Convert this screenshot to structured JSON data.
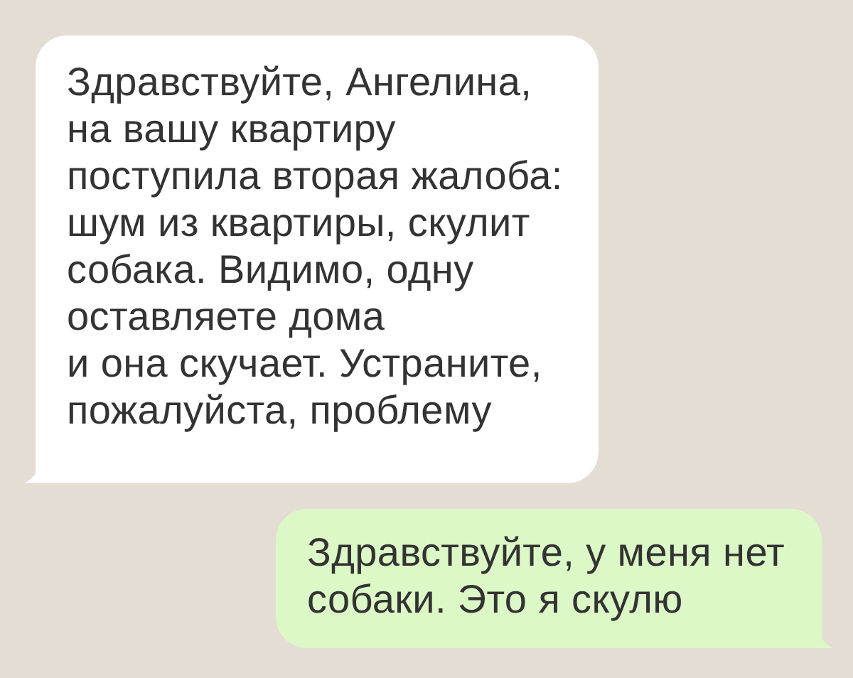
{
  "messages": [
    {
      "kind": "incoming",
      "text": "Здравствуйте, Ангелина,\nна вашу квартиру\nпоступила вторая жалоба:\nшум из квартиры, скулит\nсобака. Видимо, одну\nоставляете дома\nи она скучает. Устраните,\nпожалуйста, проблему"
    },
    {
      "kind": "outgoing",
      "text": "Здравствуйте, у меня нет\nсобаки. Это я скулю"
    }
  ]
}
